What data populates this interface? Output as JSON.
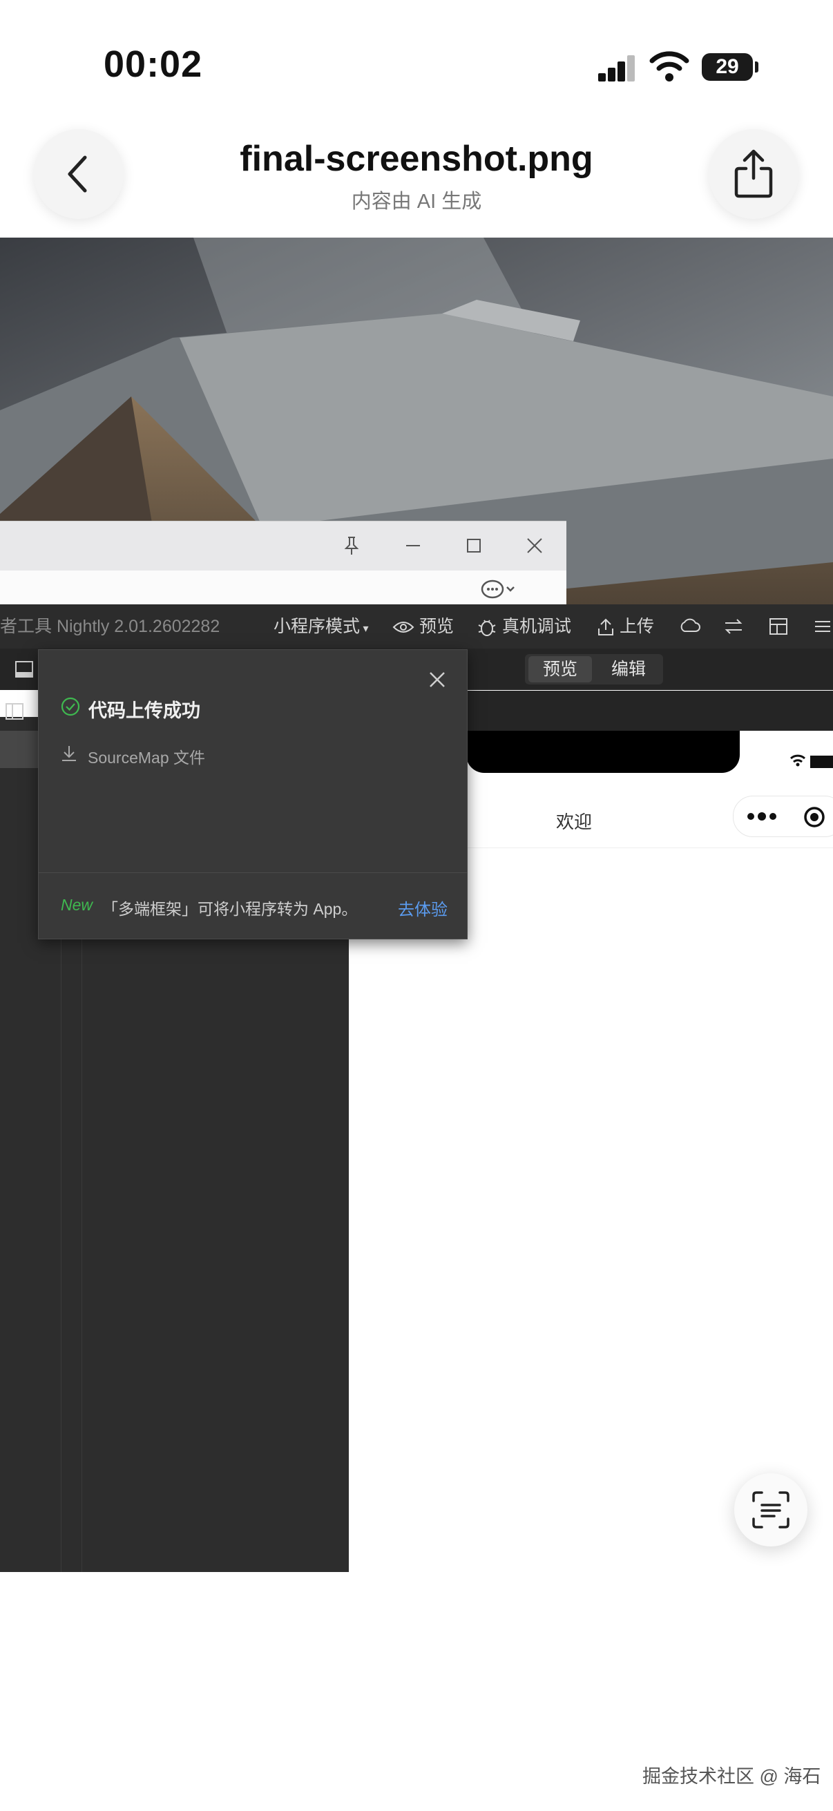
{
  "status_bar": {
    "time": "00:02",
    "battery": "29"
  },
  "header": {
    "title": "final-screenshot.png",
    "subtitle": "内容由 AI 生成"
  },
  "ide": {
    "app_title": "者工具 Nightly 2.01.2602282",
    "mode": "小程序模式",
    "toolbar": {
      "preview": "预览",
      "debug": "真机调试",
      "upload": "上传"
    },
    "tabs": {
      "preview": "预览",
      "edit": "编辑"
    },
    "dialog": {
      "title": "代码上传成功",
      "sourcemap": "SourceMap 文件",
      "new_badge": "New",
      "promo": "「多端框架」可将小程序转为 App。",
      "action": "去体验"
    },
    "simulator": {
      "page_title": "欢迎"
    }
  },
  "watermark": "掘金技术社区 @ 海石",
  "colors": {
    "success": "#3fb950",
    "link": "#5b9cf0",
    "dark_bg": "#2d2d2d"
  }
}
